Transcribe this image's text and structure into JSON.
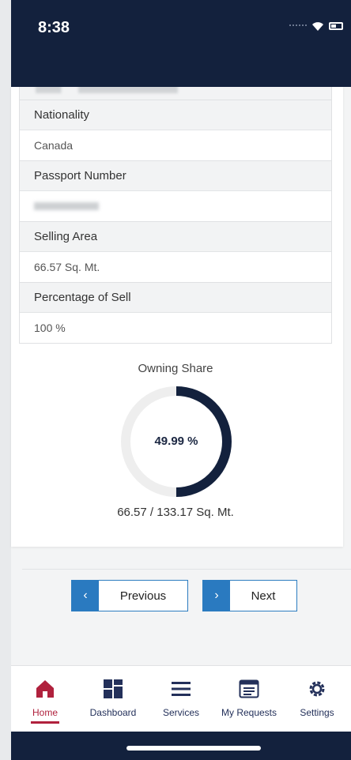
{
  "status_bar": {
    "time": "8:38"
  },
  "fields": [
    {
      "label": "Nationality",
      "value": "Canada"
    },
    {
      "label": "Passport Number",
      "value": ""
    },
    {
      "label": "Selling Area",
      "value": "66.57 Sq. Mt."
    },
    {
      "label": "Percentage of Sell",
      "value": "100 %"
    }
  ],
  "owning_share": {
    "title": "Owning Share",
    "percent_label": "49.99 %",
    "percent": 49.99,
    "area_label": "66.57 / 133.17 Sq. Mt.",
    "fill_color": "#13213d",
    "track_color": "#eeeeee"
  },
  "navigation": {
    "previous_label": "Previous",
    "previous_arrow": "‹",
    "next_label": "Next",
    "next_arrow": "›"
  },
  "tabbar": {
    "items": [
      {
        "label": "Home",
        "icon": "home-icon",
        "active": true
      },
      {
        "label": "Dashboard",
        "icon": "dashboard-icon",
        "active": false
      },
      {
        "label": "Services",
        "icon": "menu-icon",
        "active": false
      },
      {
        "label": "My Requests",
        "icon": "requests-icon",
        "active": false
      },
      {
        "label": "Settings",
        "icon": "gear-icon",
        "active": false
      }
    ]
  },
  "colors": {
    "header": "#13213d",
    "accent": "#2a7ac0",
    "active_tab": "#b0213d"
  }
}
